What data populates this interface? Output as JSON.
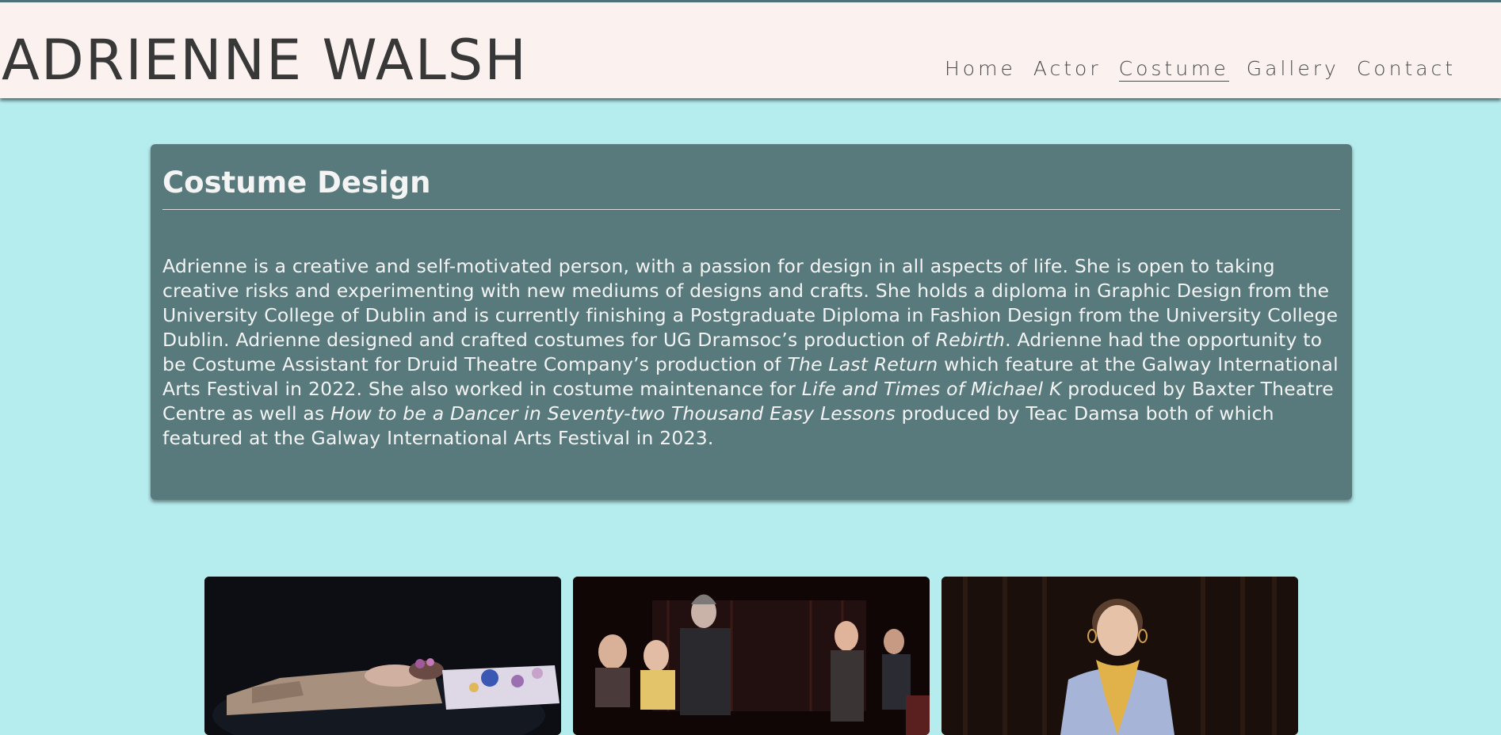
{
  "site": {
    "title": "ADRIENNE WALSH"
  },
  "nav": {
    "items": [
      {
        "label": "Home"
      },
      {
        "label": "Actor"
      },
      {
        "label": "Costume"
      },
      {
        "label": "Gallery"
      },
      {
        "label": "Contact"
      }
    ],
    "active": "Costume"
  },
  "main": {
    "heading": "Costume Design",
    "bio": {
      "seg1": "Adrienne is a creative and self-motivated person, with a passion for design in all aspects of life. She is open to taking creative risks and experimenting with new mediums of designs and crafts. She holds a diploma in Graphic Design from the University College of Dublin and is currently finishing a Postgraduate Diploma in Fashion Design from the University College Dublin. Adrienne designed and crafted costumes for UG Dramsoc’s production of ",
      "title1": "Rebirth",
      "seg2": ". Adrienne had the opportunity to be Costume Assistant for Druid Theatre Company’s production of ",
      "title2": "The Last Return",
      "seg3": " which feature at the Galway International Arts Festival in 2022. She also worked in costume maintenance for ",
      "title3": "Life and Times of Michael K",
      "seg4": " produced by Baxter Theatre Centre as well as ",
      "title4": "How to be a Dancer in Seventy-two Thousand Easy Lessons",
      "seg5": " produced by Teac Damsa both of which featured at the Galway International Arts Festival in 2023."
    }
  },
  "gallery": {
    "photos": [
      {
        "subject": "performer lying down in floral costume"
      },
      {
        "subject": "ensemble cast on stage"
      },
      {
        "subject": "performer in floral dress with yellow scarf"
      }
    ]
  }
}
